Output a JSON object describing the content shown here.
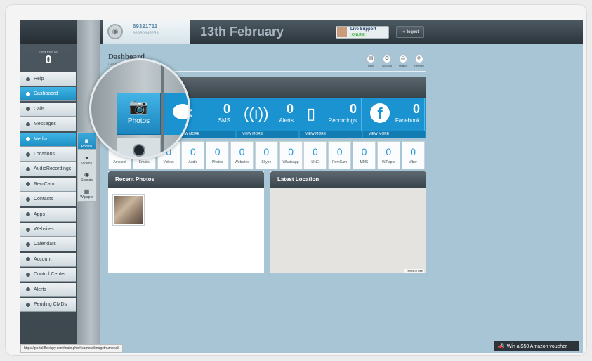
{
  "header": {
    "user_id": "69321711",
    "user_phone": "66950645253",
    "date": "13th February",
    "live_support": {
      "title": "Live Support",
      "status": "ONLINE"
    },
    "logout_label": "logout"
  },
  "sidebar": {
    "events_label": "new events",
    "events_count": "0",
    "items": [
      {
        "label": "Help",
        "icon": "info-icon"
      },
      {
        "label": "Dashboard",
        "icon": "dashboard-icon"
      },
      {
        "label": "Calls",
        "icon": "phone-icon"
      },
      {
        "label": "Messages",
        "icon": "message-icon"
      },
      {
        "label": "Media",
        "icon": "media-icon"
      },
      {
        "label": "Locations",
        "icon": "location-icon"
      },
      {
        "label": "AudioRecordings",
        "icon": "audio-icon"
      },
      {
        "label": "RemCam",
        "icon": "camera-icon"
      },
      {
        "label": "Contacts",
        "icon": "contacts-icon"
      },
      {
        "label": "Apps",
        "icon": "apps-icon"
      },
      {
        "label": "Websites",
        "icon": "link-icon"
      },
      {
        "label": "Calendars",
        "icon": "calendar-icon"
      },
      {
        "label": "Account",
        "icon": "user-icon"
      },
      {
        "label": "Control Center",
        "icon": "control-icon"
      },
      {
        "label": "Alerts",
        "icon": "alert-icon"
      },
      {
        "label": "Pending CMDs",
        "icon": "pending-icon"
      }
    ],
    "active_item": "Dashboard",
    "hover_item": "Media"
  },
  "media_subnav": [
    {
      "label": "Photos",
      "icon": "camera-icon"
    },
    {
      "label": "Videos",
      "icon": "video-icon"
    },
    {
      "label": "Sounds",
      "icon": "sound-icon"
    },
    {
      "label": "W.paper",
      "icon": "wallpaper-icon"
    }
  ],
  "dashboard": {
    "title": "Dashboard",
    "subtitle": "Get an overview of your device's",
    "tools": [
      {
        "label": "view",
        "icon": "view-icon"
      },
      {
        "label": "account",
        "icon": "settings-icon"
      },
      {
        "label": "search",
        "icon": "search-icon"
      },
      {
        "label": "Refresh",
        "icon": "refresh-icon"
      }
    ],
    "stats": [
      {
        "label": "SMS",
        "value": "0",
        "more": "VIEW MORE"
      },
      {
        "label": "Alerts",
        "value": "0",
        "more": "VIEW MORE"
      },
      {
        "label": "Recordings",
        "value": "0",
        "more": "VIEW MORE"
      },
      {
        "label": "Facebook",
        "value": "0",
        "more": "VIEW MORE"
      }
    ],
    "counts": [
      {
        "label": "Ambient",
        "value": "0"
      },
      {
        "label": "Emails",
        "value": "0"
      },
      {
        "label": "Videos",
        "value": "0"
      },
      {
        "label": "Audio",
        "value": "0"
      },
      {
        "label": "Photos",
        "value": "0"
      },
      {
        "label": "Websites",
        "value": "0"
      },
      {
        "label": "Skype",
        "value": "0"
      },
      {
        "label": "WhatsApp",
        "value": "0"
      },
      {
        "label": "LINE",
        "value": "0"
      },
      {
        "label": "RemCam",
        "value": "0"
      },
      {
        "label": "MMS",
        "value": "0"
      },
      {
        "label": "W.Paper",
        "value": "0"
      },
      {
        "label": "Viber",
        "value": "0"
      }
    ],
    "recent_photos_title": "Recent Photos",
    "latest_location_title": "Latest Location",
    "terms_label": "Terms of Use"
  },
  "magnifier": {
    "label": "Photos"
  },
  "status_url": "https://portal.flexispy.com/main.php#/camera/imagethumbnail",
  "voucher_label": "Win a $50 Amazon voucher",
  "colors": {
    "accent": "#1a93d0",
    "background": "#a7c5d4"
  }
}
